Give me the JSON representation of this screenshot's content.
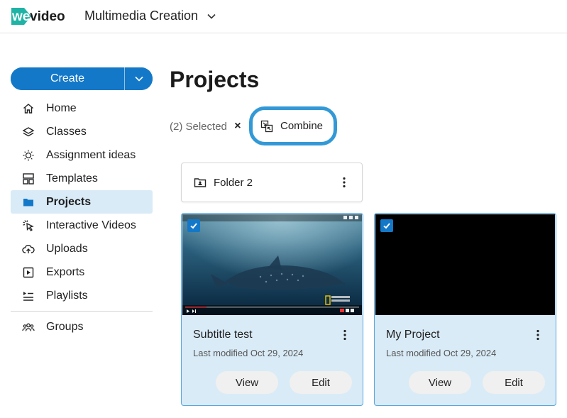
{
  "header": {
    "logo_text": "wevideo",
    "workspace_name": "Multimedia Creation"
  },
  "sidebar": {
    "create_label": "Create",
    "items": [
      {
        "label": "Home",
        "icon": "home-icon"
      },
      {
        "label": "Classes",
        "icon": "layers-icon"
      },
      {
        "label": "Assignment ideas",
        "icon": "lightbulb-icon"
      },
      {
        "label": "Templates",
        "icon": "templates-icon"
      },
      {
        "label": "Projects",
        "icon": "folder-icon",
        "active": true
      },
      {
        "label": "Interactive Videos",
        "icon": "cursor-click-icon"
      },
      {
        "label": "Uploads",
        "icon": "cloud-upload-icon"
      },
      {
        "label": "Exports",
        "icon": "export-icon"
      },
      {
        "label": "Playlists",
        "icon": "playlist-icon"
      }
    ],
    "secondary_items": [
      {
        "label": "Groups",
        "icon": "groups-icon"
      }
    ]
  },
  "main": {
    "title": "Projects",
    "selection": {
      "count_label": "(2) Selected",
      "clear_label": "×",
      "combine_label": "Combine"
    },
    "folders": [
      {
        "name": "Folder 2"
      }
    ],
    "projects": [
      {
        "title": "Subtitle test",
        "modified": "Last modified Oct 29, 2024",
        "view_label": "View",
        "edit_label": "Edit",
        "selected": true,
        "thumbnail": "underwater-whale-shark"
      },
      {
        "title": "My Project",
        "modified": "Last modified Oct 29, 2024",
        "view_label": "View",
        "edit_label": "Edit",
        "selected": true,
        "thumbnail": "black"
      }
    ]
  },
  "colors": {
    "accent": "#1478c8",
    "highlight_ring": "#3399d6",
    "selected_card_bg": "#d9ebf7",
    "logo_teal": "#1fb3a6"
  }
}
